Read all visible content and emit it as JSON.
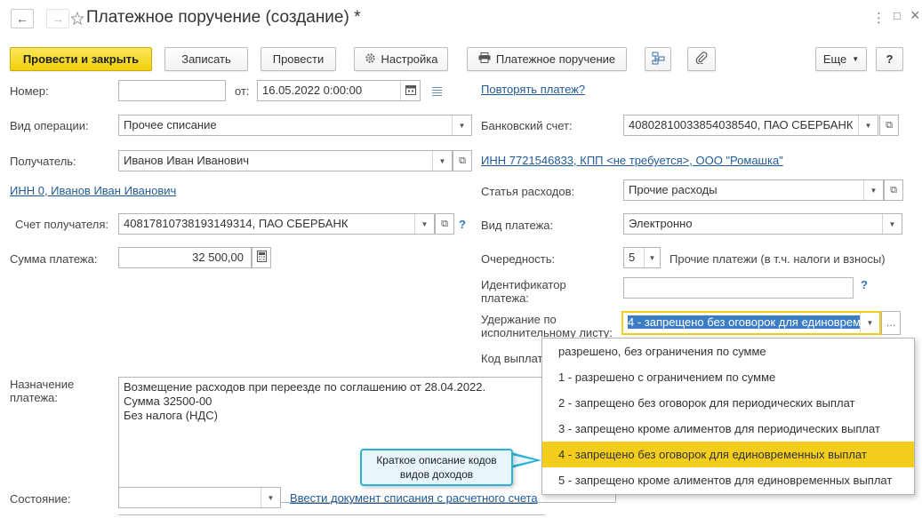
{
  "window": {
    "title": "Платежное поручение (создание) *",
    "more_icon": "⋮",
    "maximize_icon": "□",
    "close_icon": "×"
  },
  "toolbar": {
    "post_close": "Провести и закрыть",
    "save": "Записать",
    "post": "Провести",
    "settings": "Настройка",
    "payment_order": "Платежное поручение",
    "more": "Еще",
    "help": "?"
  },
  "form": {
    "number_label": "Номер:",
    "number_value": "",
    "from_label": "от:",
    "date_value": "16.05.2022  0:00:00",
    "repeat_link": "Повторять платеж?",
    "operation_label": "Вид операции:",
    "operation_value": "Прочее списание",
    "bank_account_label": "Банковский счет:",
    "bank_account_value": "40802810033854038540, ПАО СБЕРБАНК",
    "recipient_label": "Получатель:",
    "recipient_value": "Иванов Иван Иванович",
    "org_link": "ИНН 7721546833, КПП <не требуется>, ООО \"Ромашка\"",
    "recipient_inn_link": "ИНН 0, Иванов Иван Иванович",
    "expense_label": "Статья расходов:",
    "expense_value": "Прочие расходы",
    "recipient_account_label": "Счет получателя:",
    "recipient_account_value": "40817810738193149314, ПАО СБЕРБАНК",
    "payment_type_label": "Вид платежа:",
    "payment_type_value": "Электронно",
    "amount_label": "Сумма платежа:",
    "amount_value": "32 500,00",
    "priority_label": "Очередность:",
    "priority_value": "5",
    "priority_desc": "Прочие платежи (в т.ч. налоги и взносы)",
    "identifier_label_1": "Идентификатор",
    "identifier_label_2": "платежа:",
    "identifier_value": "",
    "withholding_label_1": "Удержание по",
    "withholding_label_2": "исполнительному листу:",
    "withholding_value": "4 - запрещено без оговорок для единовременных выплат",
    "income_code_label": "Код выплаты:",
    "purpose_label_1": "Назначение",
    "purpose_label_2": "платежа:",
    "purpose_line_1": "Возмещение расходов при переезде по соглашению от 28.04.2022.",
    "purpose_line_2": "Сумма 32500-00",
    "purpose_line_3": "Без налога (НДС)",
    "state_label": "Состояние:",
    "state_value": "",
    "writeoff_link": "Ввести документ списания с расчетного счета"
  },
  "dropdown": {
    "items": [
      "разрешено, без ограничения по сумме",
      "1 - разрешено с ограничением по сумме",
      "2 - запрещено без оговорок для периодических выплат",
      "3 - запрещено кроме алиментов для периодических выплат",
      "4 - запрещено без оговорок для единовременных выплат",
      "5 - запрещено кроме алиментов для единовременных выплат"
    ],
    "selected_index": 4
  },
  "callout": {
    "line_1": "Краткое описание кодов",
    "line_2": "видов доходов"
  },
  "colors": {
    "primary_button": "#f2d10a",
    "selection": "#f3cd1c",
    "link": "#1f5a96",
    "callout_border": "#2ab3d3"
  }
}
